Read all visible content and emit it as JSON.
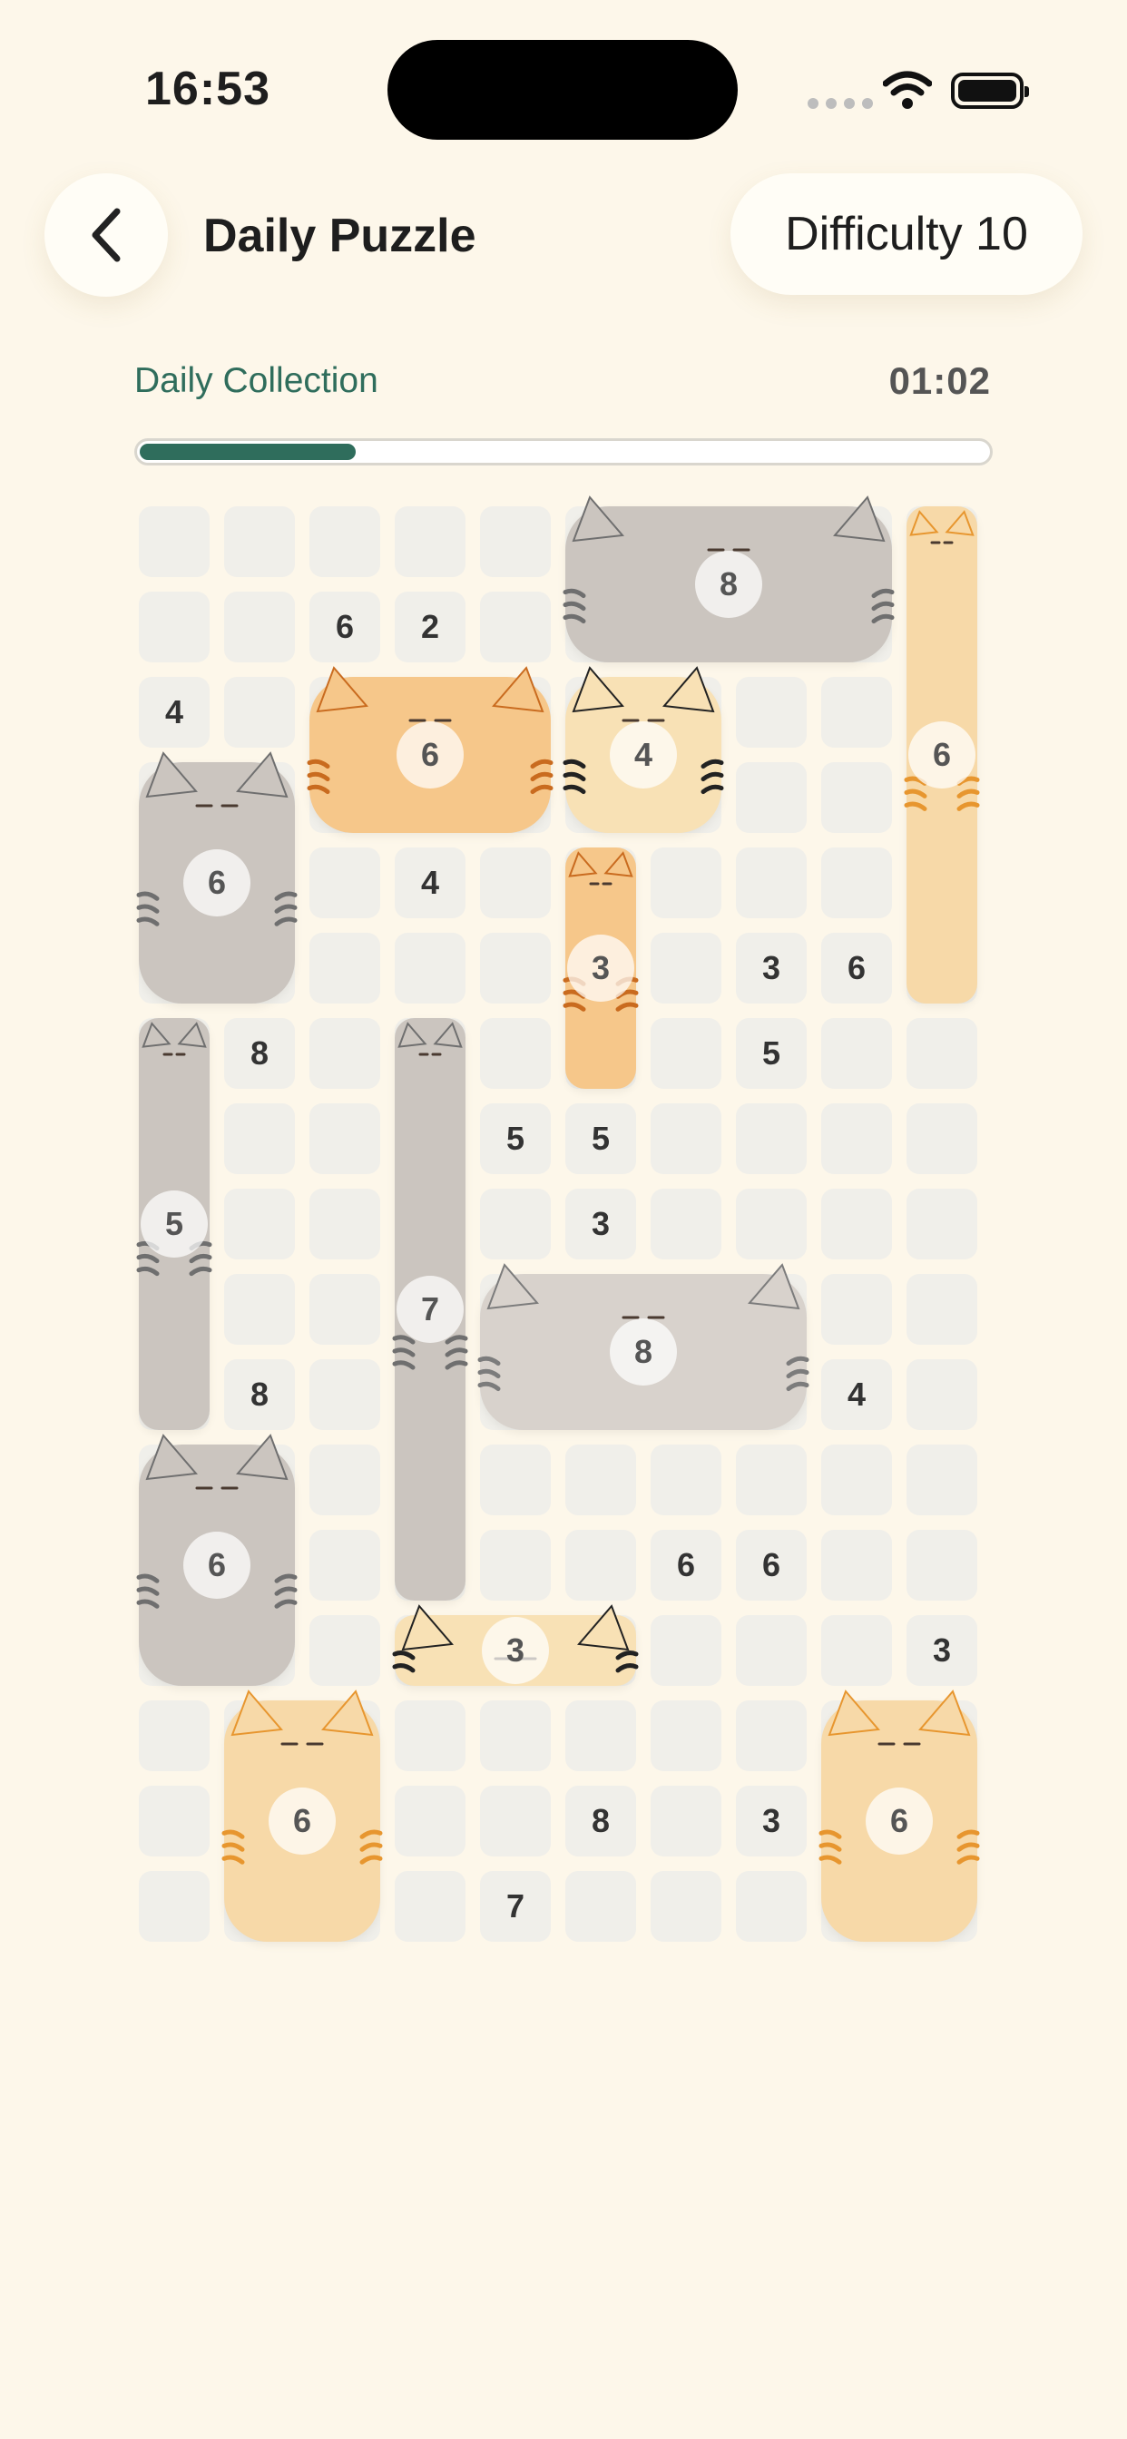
{
  "status": {
    "time": "16:53"
  },
  "header": {
    "title": "Daily Puzzle",
    "difficulty": "Difficulty 10"
  },
  "progress": {
    "label": "Daily Collection",
    "timer": "01:02",
    "fraction": 0.255
  },
  "grid": {
    "rows": 17,
    "cols": 10
  },
  "clues": [
    {
      "r": 1,
      "c": 2,
      "v": "6"
    },
    {
      "r": 1,
      "c": 3,
      "v": "2"
    },
    {
      "r": 2,
      "c": 0,
      "v": "4"
    },
    {
      "r": 4,
      "c": 3,
      "v": "4"
    },
    {
      "r": 5,
      "c": 7,
      "v": "3"
    },
    {
      "r": 5,
      "c": 8,
      "v": "6"
    },
    {
      "r": 6,
      "c": 1,
      "v": "8"
    },
    {
      "r": 6,
      "c": 7,
      "v": "5"
    },
    {
      "r": 7,
      "c": 4,
      "v": "5"
    },
    {
      "r": 7,
      "c": 5,
      "v": "5"
    },
    {
      "r": 8,
      "c": 5,
      "v": "3"
    },
    {
      "r": 10,
      "c": 1,
      "v": "8"
    },
    {
      "r": 10,
      "c": 8,
      "v": "4"
    },
    {
      "r": 12,
      "c": 6,
      "v": "6"
    },
    {
      "r": 12,
      "c": 7,
      "v": "6"
    },
    {
      "r": 13,
      "c": 9,
      "v": "3"
    },
    {
      "r": 15,
      "c": 5,
      "v": "8"
    },
    {
      "r": 15,
      "c": 7,
      "v": "3"
    },
    {
      "r": 16,
      "c": 4,
      "v": "7"
    }
  ],
  "cats": [
    {
      "id": "grey-tabby-top",
      "r": 0,
      "c": 5,
      "w": 4,
      "h": 2,
      "num": "8",
      "color": "#cbc5bf",
      "stripe": "#6f6f6f",
      "dir": "h"
    },
    {
      "id": "calico-vertical-right",
      "r": 0,
      "c": 9,
      "w": 1,
      "h": 6,
      "num": "6",
      "color": "#f7d9a8",
      "stripe": "#e7962f",
      "dir": "v"
    },
    {
      "id": "orange-tabby",
      "r": 2,
      "c": 2,
      "w": 3,
      "h": 2,
      "num": "6",
      "color": "#f6c78a",
      "stripe": "#c96b1f",
      "dir": "h"
    },
    {
      "id": "tuxedo-cat",
      "r": 2,
      "c": 5,
      "w": 2,
      "h": 2,
      "num": "4",
      "color": "#f8e1b5",
      "stripe": "#222222",
      "dir": "h"
    },
    {
      "id": "grey-tabby-left",
      "r": 3,
      "c": 0,
      "w": 2,
      "h": 3,
      "num": "6",
      "color": "#cbc5bf",
      "stripe": "#6f6f6f",
      "dir": "v"
    },
    {
      "id": "orange-small-vertical",
      "r": 4,
      "c": 5,
      "w": 1,
      "h": 3,
      "num": "3",
      "color": "#f6c78a",
      "stripe": "#c96b1f",
      "dir": "v"
    },
    {
      "id": "grey-thin-left",
      "r": 6,
      "c": 0,
      "w": 1,
      "h": 5,
      "num": "5",
      "color": "#cbc5bf",
      "stripe": "#6f6f6f",
      "dir": "v"
    },
    {
      "id": "grey-thin-middle",
      "r": 6,
      "c": 3,
      "w": 1,
      "h": 7,
      "num": "7",
      "color": "#cbc5bf",
      "stripe": "#6f6f6f",
      "dir": "v"
    },
    {
      "id": "grey-wide-middle",
      "r": 9,
      "c": 4,
      "w": 4,
      "h": 2,
      "num": "8",
      "color": "#d8d2cc",
      "stripe": "#7c7c7c",
      "dir": "h"
    },
    {
      "id": "grey-calico-left",
      "r": 11,
      "c": 0,
      "w": 2,
      "h": 3,
      "num": "6",
      "color": "#cbc5bf",
      "stripe": "#6f6f6f",
      "dir": "v"
    },
    {
      "id": "calico-thin-horizontal",
      "r": 13,
      "c": 3,
      "w": 3,
      "h": 1,
      "num": "3",
      "color": "#f8e1b5",
      "stripe": "#222222",
      "dir": "h"
    },
    {
      "id": "calico-bottom-left",
      "r": 14,
      "c": 1,
      "w": 2,
      "h": 3,
      "num": "6",
      "color": "#f7d9a8",
      "stripe": "#e7962f",
      "dir": "v"
    },
    {
      "id": "calico-bottom-right",
      "r": 14,
      "c": 8,
      "w": 2,
      "h": 3,
      "num": "6",
      "color": "#f7d9a8",
      "stripe": "#e7962f",
      "dir": "v"
    }
  ]
}
